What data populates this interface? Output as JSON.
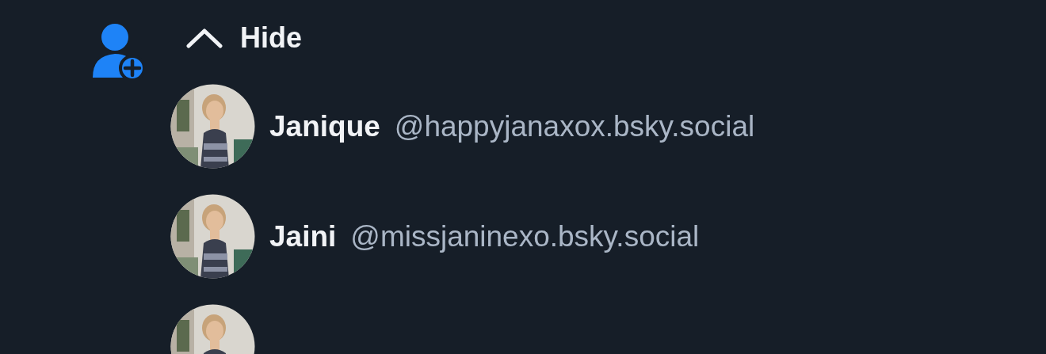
{
  "toggle": {
    "label": "Hide",
    "expanded": true
  },
  "users": [
    {
      "name": "Janique",
      "handle": "@happyjanaxox.bsky.social"
    },
    {
      "name": "Jaini",
      "handle": "@missjaninexo.bsky.social"
    }
  ]
}
